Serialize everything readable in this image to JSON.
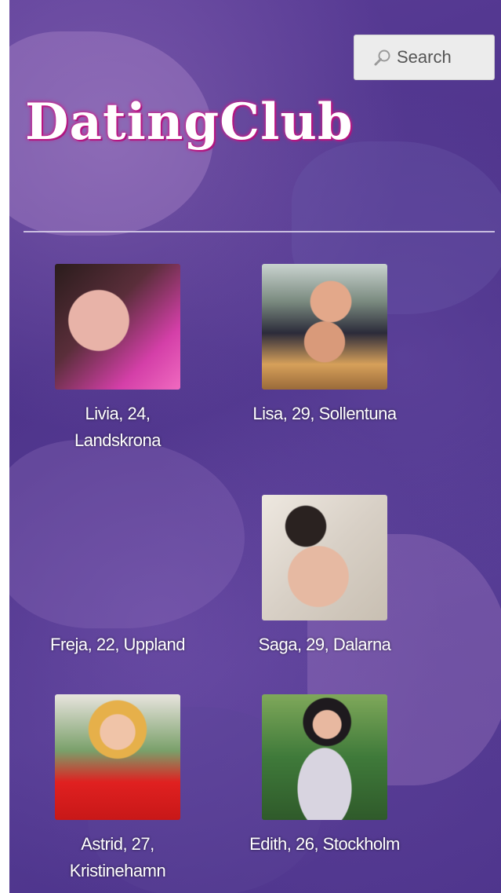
{
  "header": {
    "logo": "DatingClub",
    "search_label": "Search"
  },
  "profiles": [
    {
      "caption": "Livia, 24, Landskrona"
    },
    {
      "caption": "Lisa, 29, Sollentuna"
    },
    {
      "caption": "Freja, 22, Uppland"
    },
    {
      "caption": "Saga, 29, Dalarna"
    },
    {
      "caption": "Astrid, 27, Kristinehamn"
    },
    {
      "caption": "Edith, 26, Stockholm"
    }
  ],
  "colors": {
    "background": "#4e358c",
    "logo_glow": "#d01a8a",
    "text": "#ffffff"
  },
  "icons": {
    "search": "magnifier-icon"
  }
}
